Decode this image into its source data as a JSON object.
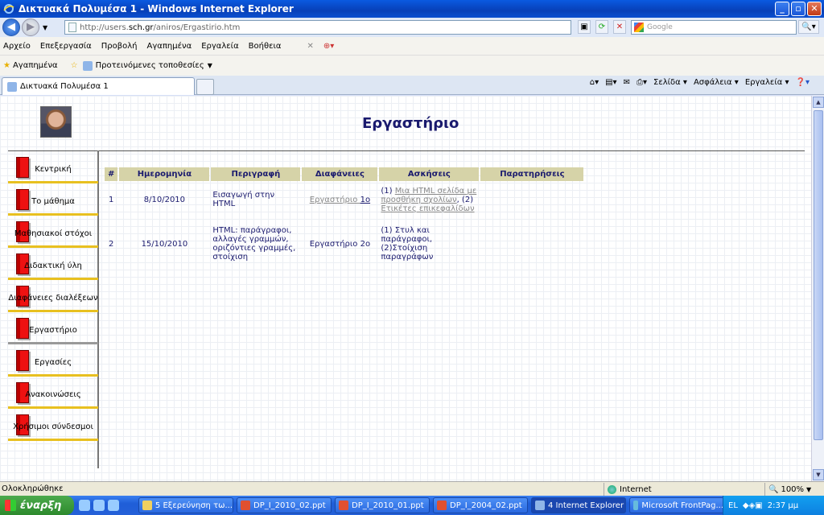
{
  "window": {
    "title": "Δικτυακά Πολυμέσα 1 - Windows Internet Explorer"
  },
  "address": {
    "prefix": "http://users.",
    "domain": "sch.gr",
    "path": "/aniros/Ergastirio.htm"
  },
  "search": {
    "placeholder": "Google"
  },
  "menu": [
    "Αρχείο",
    "Επεξεργασία",
    "Προβολή",
    "Αγαπημένα",
    "Εργαλεία",
    "Βοήθεια"
  ],
  "favorites": {
    "label": "Αγαπημένα",
    "suggested": "Προτεινόμενες τοποθεσίες"
  },
  "tab": {
    "title": "Δικτυακά Πολυμέσα 1"
  },
  "cmdbar": {
    "page": "Σελίδα",
    "safety": "Ασφάλεια",
    "tools": "Εργαλεία"
  },
  "page": {
    "heading": "Εργαστήριο",
    "nav": [
      {
        "label": "Κεντρική",
        "active": false
      },
      {
        "label": "Το μάθημα",
        "active": false
      },
      {
        "label": "Μαθησιακοί στόχοι",
        "active": false
      },
      {
        "label": "Διδακτική ύλη",
        "active": false
      },
      {
        "label": "Διαφάνειες διαλέξεων",
        "active": false
      },
      {
        "label": "Εργαστήριο",
        "active": true
      },
      {
        "label": "Εργασίες",
        "active": false
      },
      {
        "label": "Ανακοινώσεις",
        "active": false
      },
      {
        "label": "Χρήσιμοι σύνδεσμοι",
        "active": false
      }
    ],
    "table": {
      "headers": [
        "#",
        "Ημερομηνία",
        "Περιγραφή",
        "Διαφάνειες",
        "Ασκήσεις",
        "Παρατηρήσεις"
      ],
      "rows": [
        {
          "num": "1",
          "date": "8/10/2010",
          "desc": "Εισαγωγή στην HTML",
          "slides_a": "Εργαστήριο ",
          "slides_b": "1ο",
          "ex_1": "(1) ",
          "ex_link1": "Μια HTML σελίδα με προσθήκη σχολίων",
          "ex_2": ", (2) ",
          "ex_link2": "Ετικέτες επικεφαλίδων",
          "notes": ""
        },
        {
          "num": "2",
          "date": "15/10/2010",
          "desc": "HTML: παράγραφοι, αλλαγές γραμμών, οριζόντιες γραμμές, στοίχιση",
          "slides": "Εργαστήριο 2ο",
          "ex_1": "(1) Στυλ και παράγραφοι, (2)Στοίχιση παραγράφων",
          "notes": ""
        }
      ]
    }
  },
  "status": {
    "text": "Ολοκληρώθηκε",
    "zone": "Internet",
    "zoom": "100%"
  },
  "taskbar": {
    "start": "έναρξη",
    "buttons": [
      "5 Εξερεύνηση τω...",
      "DP_I_2010_02.ppt",
      "DP_I_2010_01.ppt",
      "DP_I_2004_02.ppt",
      "4 Internet Explorer",
      "Microsoft FrontPag..."
    ],
    "lang": "EL",
    "clock": "2:37 μμ"
  }
}
